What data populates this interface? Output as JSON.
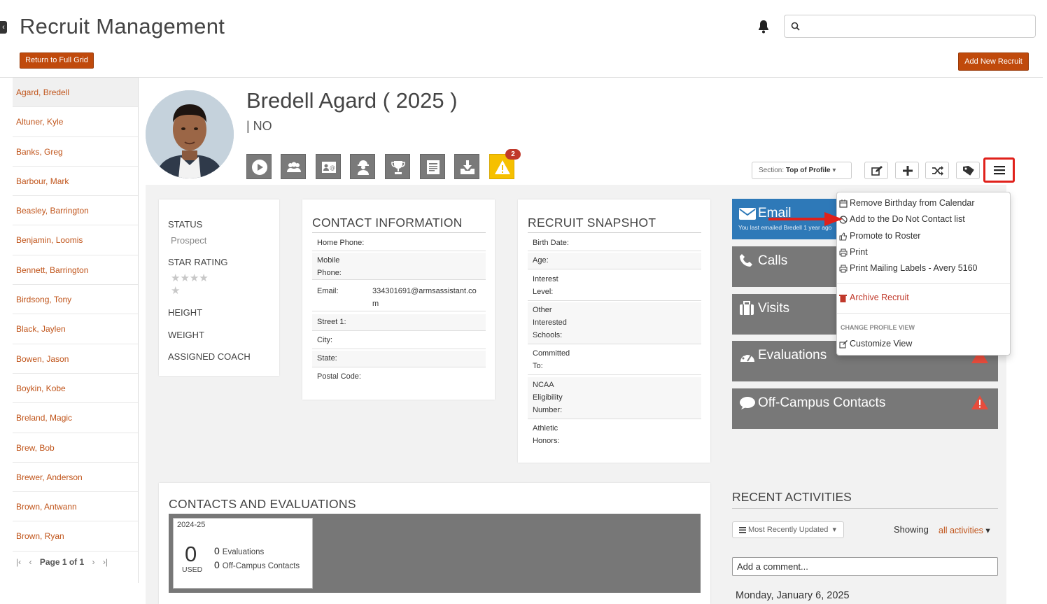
{
  "header": {
    "title": "Recruit Management",
    "return_label": "Return to Full Grid",
    "add_label": "Add New Recruit",
    "search_placeholder": ""
  },
  "sidebar": {
    "items": [
      "Agard, Bredell",
      "Altuner, Kyle",
      "Banks, Greg",
      "Barbour, Mark",
      "Beasley, Barrington",
      "Benjamin, Loomis",
      "Bennett, Barrington",
      "Birdsong, Tony",
      "Black, Jaylen",
      "Bowen, Jason",
      "Boykin, Kobe",
      "Breland, Magic",
      "Brew, Bob",
      "Brewer, Anderson",
      "Brown, Antwann",
      "Brown, Ryan"
    ],
    "active_index": 0,
    "pager": "Page 1 of 1"
  },
  "profile": {
    "name": "Bredell Agard ( 2025 )",
    "sub": "| NO",
    "alert_count": "2"
  },
  "section": {
    "label": "Section:",
    "value": "Top of Profile"
  },
  "status_card": {
    "status_label": "STATUS",
    "status_value": "Prospect",
    "star_label": "STAR RATING",
    "stars": 0,
    "stars_max": 5,
    "height_label": "HEIGHT",
    "weight_label": "WEIGHT",
    "coach_label": "ASSIGNED COACH"
  },
  "contact": {
    "title": "CONTACT INFORMATION",
    "home_phone": "Home Phone:",
    "mobile_1": "Mobile",
    "mobile_2": "Phone:",
    "email_label": "Email:",
    "email_1": "334301691@armsassistant.co",
    "email_2": "m",
    "street": "Street 1:",
    "city": "City:",
    "state": "State:",
    "postal": "Postal Code:"
  },
  "snapshot": {
    "title": "RECRUIT SNAPSHOT",
    "birth": "Birth Date:",
    "age": "Age:",
    "interest_1": "Interest",
    "interest_2": "Level:",
    "other_1": "Other",
    "other_2": "Interested",
    "other_3": "Schools:",
    "committed_1": "Committed",
    "committed_2": "To:",
    "ncaa_1": "NCAA",
    "ncaa_2": "Eligibility",
    "ncaa_3": "Number:",
    "athletic_1": "Athletic",
    "athletic_2": "Honors:"
  },
  "tiles": {
    "email": "Email",
    "email_sub": "You last emailed Bredell 1 year ago",
    "calls": "Calls",
    "visits": "Visits",
    "evaluations": "Evaluations",
    "offcampus": "Off-Campus Contacts"
  },
  "menu": {
    "remove_birthday": "Remove Birthday from Calendar",
    "dnc": "Add to the Do Not Contact list",
    "promote": "Promote to Roster",
    "print": "Print",
    "labels": "Print Mailing Labels - Avery 5160",
    "archive": "Archive Recruit",
    "change_header": "CHANGE PROFILE VIEW",
    "customize": "Customize View"
  },
  "contacts_evals": {
    "title": "CONTACTS AND EVALUATIONS",
    "season": "2024-25",
    "used_count": "0",
    "used_label": "USED",
    "eval_count": "0",
    "eval_label": "Evaluations",
    "off_count": "0",
    "off_label": "Off-Campus Contacts"
  },
  "recent": {
    "title": "RECENT ACTIVITIES",
    "sort": "Most Recently Updated",
    "showing": "Showing",
    "filter": "all activities",
    "comment_placeholder": "Add a comment...",
    "date": "Monday, January 6, 2025"
  },
  "colors": {
    "accent": "#c04a0c",
    "email_tile": "#2e79b8",
    "tile": "#787878",
    "alert": "#f6c000",
    "danger": "#e0211b"
  }
}
